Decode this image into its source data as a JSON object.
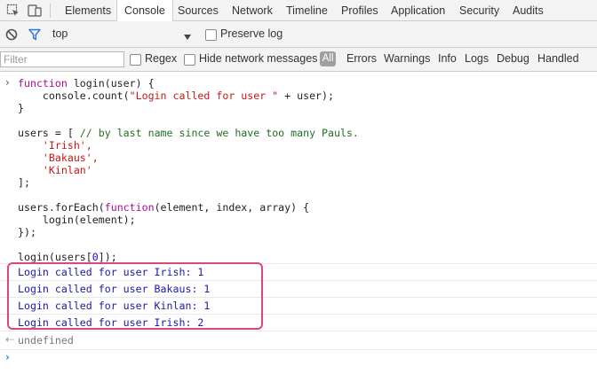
{
  "tabs": [
    {
      "label": "Elements"
    },
    {
      "label": "Console"
    },
    {
      "label": "Sources"
    },
    {
      "label": "Network"
    },
    {
      "label": "Timeline"
    },
    {
      "label": "Profiles"
    },
    {
      "label": "Application"
    },
    {
      "label": "Security"
    },
    {
      "label": "Audits"
    }
  ],
  "active_tab": "Console",
  "context": {
    "value": "top",
    "preserve_log": "Preserve log"
  },
  "filter": {
    "placeholder": "Filter",
    "regex": "Regex",
    "hide_network": "Hide network messages",
    "levels": [
      "All",
      "Errors",
      "Warnings",
      "Info",
      "Logs",
      "Debug",
      "Handled"
    ]
  },
  "code": {
    "l1_kw": "function",
    "l1_rest": " login(user) {",
    "l2_a": "    console.count(",
    "l2_str": "\"Login called for user \"",
    "l2_b": " + user);",
    "l3": "}",
    "l5_a": "users = [ ",
    "l5_cmt": "// by last name since we have too many Pauls.",
    "l6": "    'Irish',",
    "l7": "    'Bakaus',",
    "l8": "    'Kinlan'",
    "l9": "];",
    "l11_a": "users.forEach(",
    "l11_kw": "function",
    "l11_b": "(element, index, array) {",
    "l12": "    login(element);",
    "l13": "});",
    "l15_a": "login(users[",
    "l15_num": "0",
    "l15_b": "]);"
  },
  "logs": [
    "Login called for user Irish: 1",
    "Login called for user Bakaus: 1",
    "Login called for user Kinlan: 1",
    "Login called for user Irish: 2"
  ],
  "result": "undefined",
  "colors": {
    "highlight_border": "#e0447c",
    "log_text": "#1a1aa6",
    "prompt": "#367cf1",
    "tab_active_underline": "#3879d9"
  }
}
